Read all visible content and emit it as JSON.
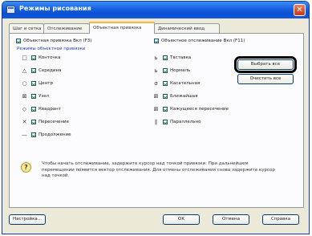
{
  "window": {
    "title": "Режимы рисования",
    "close_symbol": "✕"
  },
  "tabs": [
    {
      "label": "Шаг и сетка",
      "active": false
    },
    {
      "label": "Отслеживание",
      "active": false
    },
    {
      "label": "Объектная привязка",
      "active": true
    },
    {
      "label": "Динамический ввод",
      "active": false
    }
  ],
  "options": {
    "osnap_on": {
      "label": "Объектная привязка Вкл (F3)",
      "checked": true
    },
    "otrack_on": {
      "label": "Объектное отслеживание Вкл (F11)",
      "checked": true
    }
  },
  "group_label": "Режимы объектной привязки",
  "left_modes": [
    {
      "symbol": "□",
      "label": "Конточка",
      "checked": true,
      "icon": "endpoint-icon"
    },
    {
      "symbol": "△",
      "label": "Середина",
      "checked": true,
      "icon": "midpoint-icon"
    },
    {
      "symbol": "○",
      "label": "Центр",
      "checked": true,
      "icon": "center-icon"
    },
    {
      "symbol": "⊠",
      "label": "Узел",
      "checked": true,
      "icon": "node-icon"
    },
    {
      "symbol": "◇",
      "label": "Квадрант",
      "checked": true,
      "icon": "quadrant-icon"
    },
    {
      "symbol": "✕",
      "label": "Пересечение",
      "checked": true,
      "icon": "intersection-icon"
    },
    {
      "symbol": "—",
      "label": "Продолжение",
      "checked": true,
      "icon": "extension-icon"
    }
  ],
  "right_modes": [
    {
      "symbol": "ь",
      "label": "Твставка",
      "checked": true,
      "icon": "insertion-icon"
    },
    {
      "symbol": "ь",
      "label": "Нормаль",
      "checked": true,
      "icon": "perpendicular-icon"
    },
    {
      "symbol": "σ",
      "label": "Касательная",
      "checked": true,
      "icon": "tangent-icon"
    },
    {
      "symbol": "⊠",
      "label": "Ближайшая",
      "checked": true,
      "icon": "nearest-icon"
    },
    {
      "symbol": "⊠",
      "label": "Кажущееся пересечение",
      "checked": true,
      "icon": "apparent-intersection-icon"
    },
    {
      "symbol": "∥",
      "label": "Параллельно",
      "checked": true,
      "icon": "parallel-icon"
    }
  ],
  "buttons": {
    "select_all": "Выбрать все",
    "clear_all": "Очистить все",
    "options": "Настройка...",
    "ok": "OK",
    "cancel": "Отмена",
    "help": "Справка"
  },
  "info": {
    "icon_symbol": "?",
    "text": "Чтобы начать отслеживание, задержите курсор над точкой привязки. При дальнейшем перемещении появится вектор отслеживания. Для отмены отслеживания снова задержите курсор над точкой."
  }
}
